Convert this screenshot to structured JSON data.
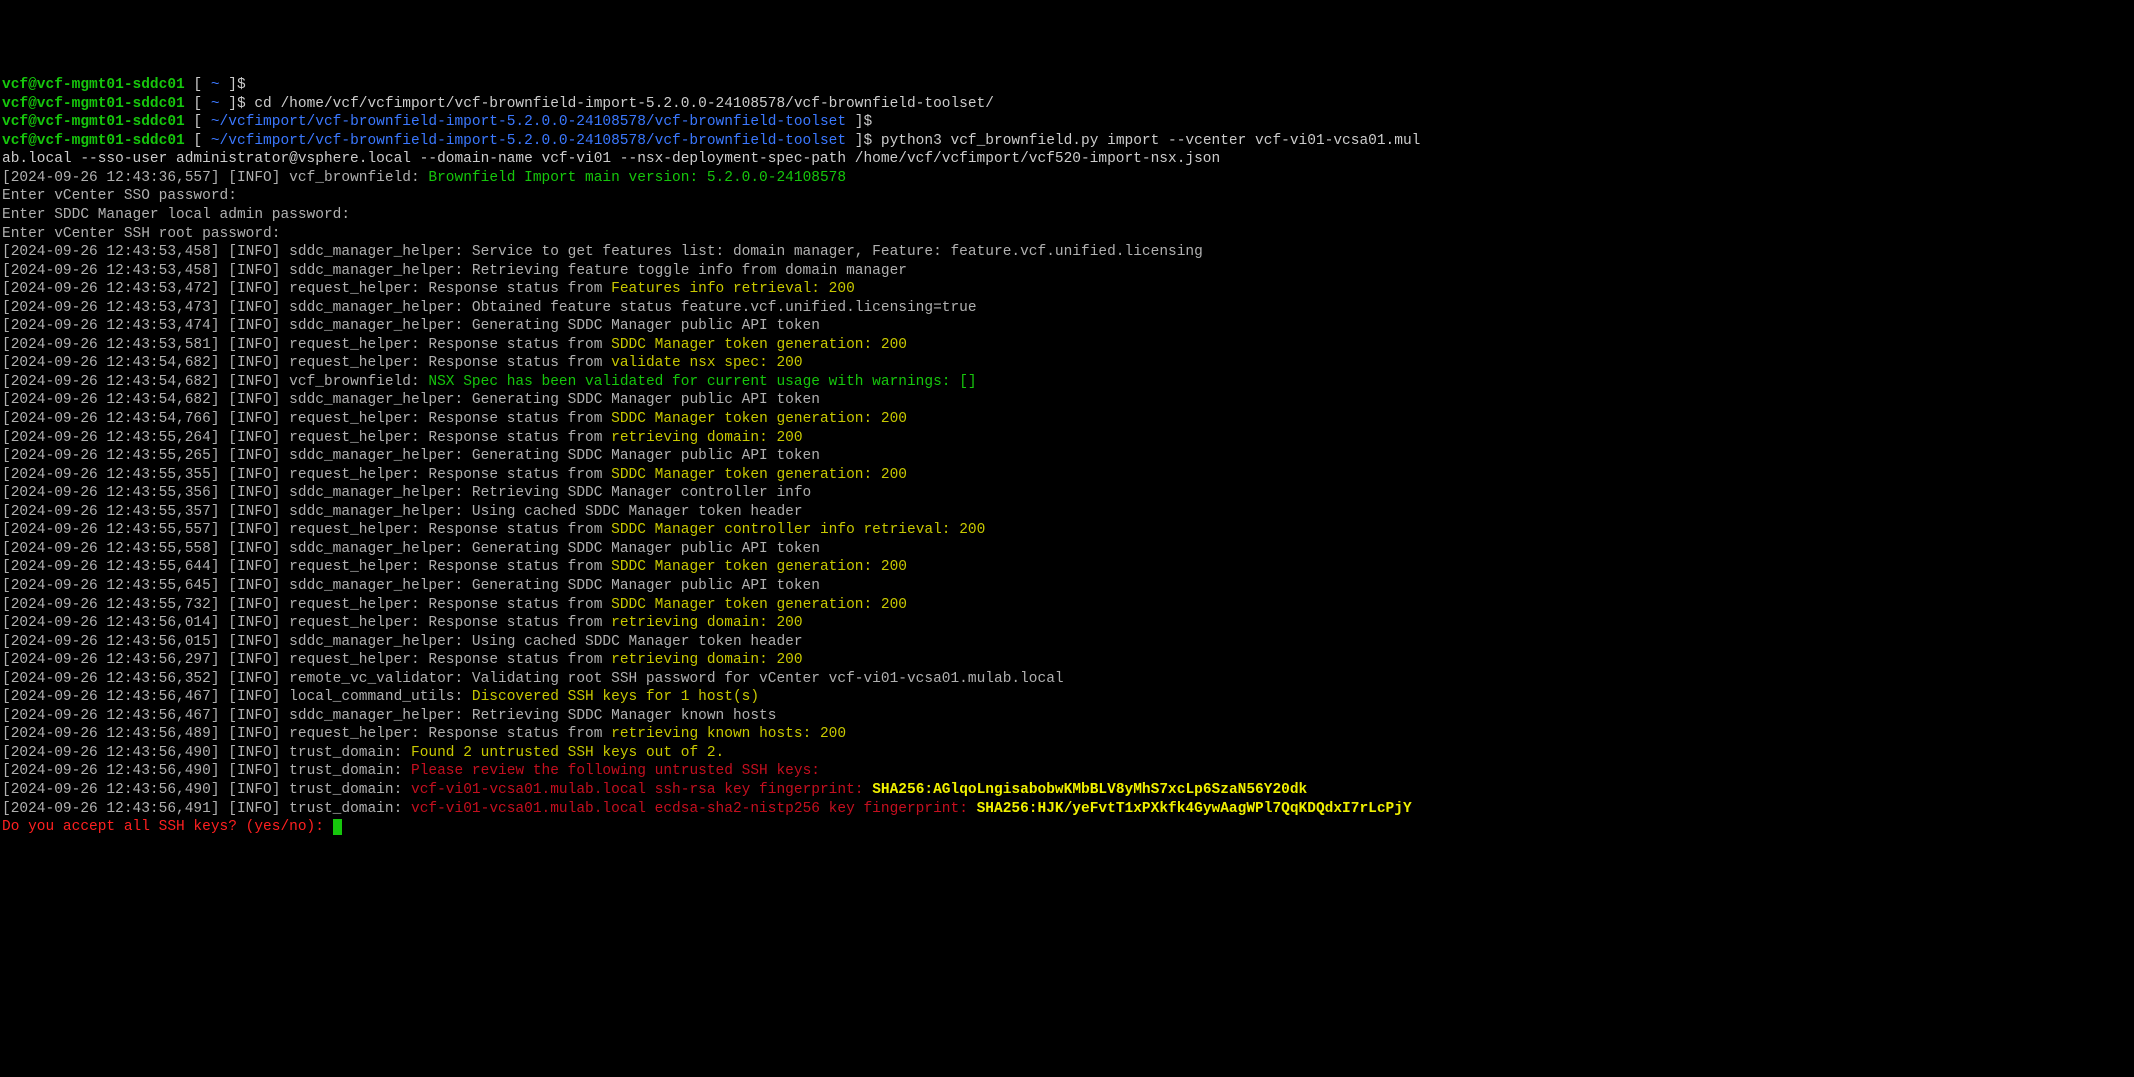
{
  "prompt": {
    "user_host": "vcf@vcf-mgmt01-sddc01",
    "open_bracket": " [ ",
    "home": "~",
    "toolset_path": "~/vcfimport/vcf-brownfield-import-5.2.0.0-24108578/vcf-brownfield-toolset",
    "close_bracket": " ]$",
    "space": " "
  },
  "commands": {
    "cd": "cd /home/vcf/vcfimport/vcf-brownfield-import-5.2.0.0-24108578/vcf-brownfield-toolset/",
    "python_part1": "python3 vcf_brownfield.py import --vcenter vcf-vi01-vcsa01.mul",
    "python_part2": "ab.local --sso-user administrator@vsphere.local --domain-name vcf-vi01 --nsx-deployment-spec-path /home/vcf/vcfimport/vcf520-import-nsx.json"
  },
  "logs": {
    "l1": {
      "ts": "[2024-09-26 12:43:36,557]",
      "lvl": "[INFO]",
      "mod": "vcf_brownfield:",
      "msg": "Brownfield Import main version: 5.2.0.0-24108578"
    },
    "p1": "Enter vCenter SSO password:",
    "p2": "Enter SDDC Manager local admin password:",
    "p3": "Enter vCenter SSH root password:",
    "l2": {
      "ts": "[2024-09-26 12:43:53,458]",
      "lvl": "[INFO]",
      "mod": "sddc_manager_helper:",
      "msg": "Service to get features list: domain manager, Feature: feature.vcf.unified.licensing"
    },
    "l3": {
      "ts": "[2024-09-26 12:43:53,458]",
      "lvl": "[INFO]",
      "mod": "sddc_manager_helper:",
      "msg": "Retrieving feature toggle info from domain manager"
    },
    "l4": {
      "ts": "[2024-09-26 12:43:53,472]",
      "lvl": "[INFO]",
      "mod": "request_helper:",
      "msg1": "Response status from ",
      "msg2": "Features info retrieval: 200"
    },
    "l5": {
      "ts": "[2024-09-26 12:43:53,473]",
      "lvl": "[INFO]",
      "mod": "sddc_manager_helper:",
      "msg": "Obtained feature status feature.vcf.unified.licensing=true"
    },
    "l6": {
      "ts": "[2024-09-26 12:43:53,474]",
      "lvl": "[INFO]",
      "mod": "sddc_manager_helper:",
      "msg": "Generating SDDC Manager public API token"
    },
    "l7": {
      "ts": "[2024-09-26 12:43:53,581]",
      "lvl": "[INFO]",
      "mod": "request_helper:",
      "msg1": "Response status from ",
      "msg2": "SDDC Manager token generation: 200"
    },
    "l8": {
      "ts": "[2024-09-26 12:43:54,682]",
      "lvl": "[INFO]",
      "mod": "request_helper:",
      "msg1": "Response status from ",
      "msg2": "validate nsx spec: 200"
    },
    "l9": {
      "ts": "[2024-09-26 12:43:54,682]",
      "lvl": "[INFO]",
      "mod": "vcf_brownfield:",
      "msg": "NSX Spec has been validated for current usage with warnings: []"
    },
    "l10": {
      "ts": "[2024-09-26 12:43:54,682]",
      "lvl": "[INFO]",
      "mod": "sddc_manager_helper:",
      "msg": "Generating SDDC Manager public API token"
    },
    "l11": {
      "ts": "[2024-09-26 12:43:54,766]",
      "lvl": "[INFO]",
      "mod": "request_helper:",
      "msg1": "Response status from ",
      "msg2": "SDDC Manager token generation: 200"
    },
    "l12": {
      "ts": "[2024-09-26 12:43:55,264]",
      "lvl": "[INFO]",
      "mod": "request_helper:",
      "msg1": "Response status from ",
      "msg2": "retrieving domain: 200"
    },
    "l13": {
      "ts": "[2024-09-26 12:43:55,265]",
      "lvl": "[INFO]",
      "mod": "sddc_manager_helper:",
      "msg": "Generating SDDC Manager public API token"
    },
    "l14": {
      "ts": "[2024-09-26 12:43:55,355]",
      "lvl": "[INFO]",
      "mod": "request_helper:",
      "msg1": "Response status from ",
      "msg2": "SDDC Manager token generation: 200"
    },
    "l15": {
      "ts": "[2024-09-26 12:43:55,356]",
      "lvl": "[INFO]",
      "mod": "sddc_manager_helper:",
      "msg": "Retrieving SDDC Manager controller info"
    },
    "l16": {
      "ts": "[2024-09-26 12:43:55,357]",
      "lvl": "[INFO]",
      "mod": "sddc_manager_helper:",
      "msg": "Using cached SDDC Manager token header"
    },
    "l17": {
      "ts": "[2024-09-26 12:43:55,557]",
      "lvl": "[INFO]",
      "mod": "request_helper:",
      "msg1": "Response status from ",
      "msg2": "SDDC Manager controller info retrieval: 200"
    },
    "l18": {
      "ts": "[2024-09-26 12:43:55,558]",
      "lvl": "[INFO]",
      "mod": "sddc_manager_helper:",
      "msg": "Generating SDDC Manager public API token"
    },
    "l19": {
      "ts": "[2024-09-26 12:43:55,644]",
      "lvl": "[INFO]",
      "mod": "request_helper:",
      "msg1": "Response status from ",
      "msg2": "SDDC Manager token generation: 200"
    },
    "l20": {
      "ts": "[2024-09-26 12:43:55,645]",
      "lvl": "[INFO]",
      "mod": "sddc_manager_helper:",
      "msg": "Generating SDDC Manager public API token"
    },
    "l21": {
      "ts": "[2024-09-26 12:43:55,732]",
      "lvl": "[INFO]",
      "mod": "request_helper:",
      "msg1": "Response status from ",
      "msg2": "SDDC Manager token generation: 200"
    },
    "l22": {
      "ts": "[2024-09-26 12:43:56,014]",
      "lvl": "[INFO]",
      "mod": "request_helper:",
      "msg1": "Response status from ",
      "msg2": "retrieving domain: 200"
    },
    "l23": {
      "ts": "[2024-09-26 12:43:56,015]",
      "lvl": "[INFO]",
      "mod": "sddc_manager_helper:",
      "msg": "Using cached SDDC Manager token header"
    },
    "l24": {
      "ts": "[2024-09-26 12:43:56,297]",
      "lvl": "[INFO]",
      "mod": "request_helper:",
      "msg1": "Response status from ",
      "msg2": "retrieving domain: 200"
    },
    "l25": {
      "ts": "[2024-09-26 12:43:56,352]",
      "lvl": "[INFO]",
      "mod": "remote_vc_validator:",
      "msg": "Validating root SSH password for vCenter vcf-vi01-vcsa01.mulab.local"
    },
    "l26": {
      "ts": "[2024-09-26 12:43:56,467]",
      "lvl": "[INFO]",
      "mod": "local_command_utils:",
      "msg": "Discovered SSH keys for 1 host(s)"
    },
    "l27": {
      "ts": "[2024-09-26 12:43:56,467]",
      "lvl": "[INFO]",
      "mod": "sddc_manager_helper:",
      "msg": "Retrieving SDDC Manager known hosts"
    },
    "l28": {
      "ts": "[2024-09-26 12:43:56,489]",
      "lvl": "[INFO]",
      "mod": "request_helper:",
      "msg1": "Response status from ",
      "msg2": "retrieving known hosts: 200"
    },
    "l29": {
      "ts": "[2024-09-26 12:43:56,490]",
      "lvl": "[INFO]",
      "mod": "trust_domain:",
      "msg": "Found 2 untrusted SSH keys out of 2."
    },
    "l30": {
      "ts": "[2024-09-26 12:43:56,490]",
      "lvl": "[INFO]",
      "mod": "trust_domain:",
      "msg": "Please review the following untrusted SSH keys:"
    },
    "l31": {
      "ts": "[2024-09-26 12:43:56,490]",
      "lvl": "[INFO]",
      "mod": "trust_domain:",
      "msg1": "vcf-vi01-vcsa01.mulab.local ssh-rsa key fingerprint: ",
      "msg2": "SHA256:AGlqoLngisabobwKMbBLV8yMhS7xcLp6SzaN56Y20dk"
    },
    "l32": {
      "ts": "[2024-09-26 12:43:56,491]",
      "lvl": "[INFO]",
      "mod": "trust_domain:",
      "msg1": "vcf-vi01-vcsa01.mulab.local ecdsa-sha2-nistp256 key fingerprint: ",
      "msg2": "SHA256:HJK/yeFvtT1xPXkfk4GywAagWPl7QqKDQdxI7rLcPjY"
    },
    "finalprompt": "Do you accept all SSH keys? (yes/no): "
  }
}
